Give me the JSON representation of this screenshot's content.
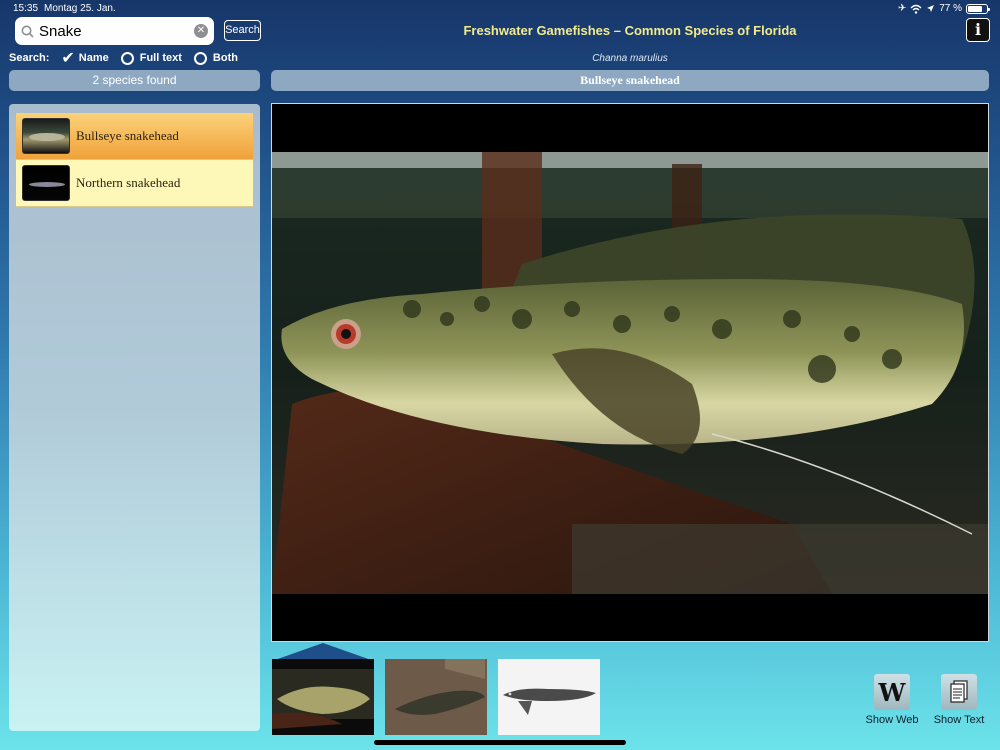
{
  "status_bar": {
    "time": "15:35",
    "date": "Montag 25. Jan.",
    "battery": "77 %",
    "battery_level": 0.77
  },
  "search": {
    "query": "Snake",
    "button_label": "Search",
    "options_label": "Search:",
    "options": [
      {
        "label": "Name",
        "selected": true
      },
      {
        "label": "Full text",
        "selected": false
      },
      {
        "label": "Both",
        "selected": false
      }
    ]
  },
  "header": {
    "title": "Freshwater Gamefishes – Common Species of Florida",
    "info_label": "i"
  },
  "results": {
    "count_label": "2 species found",
    "items": [
      {
        "name": "Bullseye snakehead",
        "selected": true
      },
      {
        "name": "Northern snakehead",
        "selected": false
      }
    ]
  },
  "detail": {
    "scientific_name": "Channa marulius",
    "common_name": "Bullseye snakehead"
  },
  "actions": {
    "web_label": "Show Web",
    "text_label": "Show Text",
    "web_glyph": "W"
  },
  "colors": {
    "title_yellow": "#f2ea8d",
    "selected_row": "#f0a13a",
    "row_bg": "#fdf8b8"
  }
}
